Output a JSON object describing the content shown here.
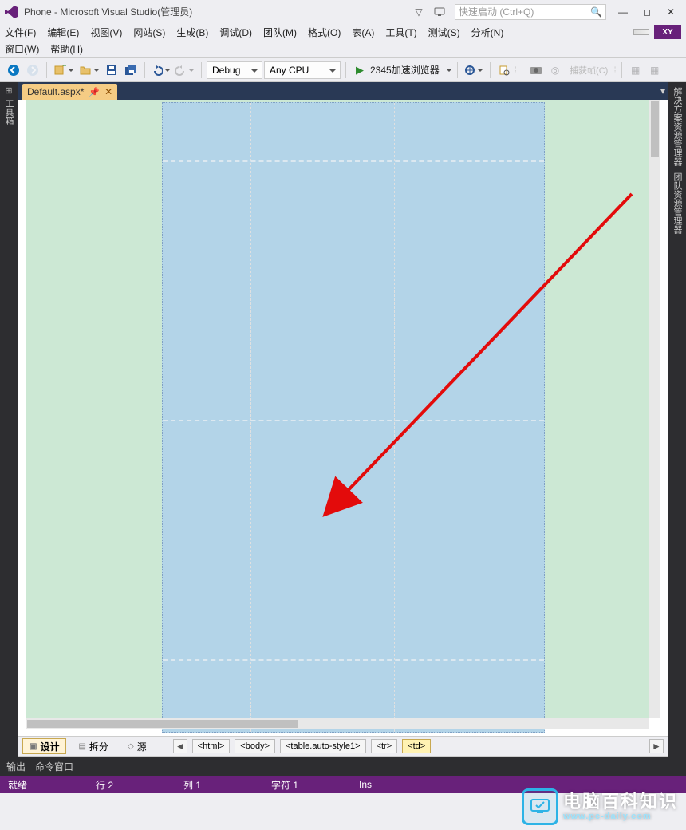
{
  "title": "Phone - Microsoft Visual Studio(管理员)",
  "search_placeholder": "快速启动 (Ctrl+Q)",
  "avatar": "XY",
  "menu1": [
    "文件(F)",
    "编辑(E)",
    "视图(V)",
    "网站(S)",
    "生成(B)",
    "调试(D)",
    "团队(M)",
    "格式(O)",
    "表(A)",
    "工具(T)",
    "测试(S)",
    "分析(N)"
  ],
  "menu2": [
    "窗口(W)",
    "帮助(H)"
  ],
  "toolbar": {
    "config": "Debug",
    "platform": "Any CPU",
    "run_label": "2345加速浏览器",
    "capture": "捕获帧(C)"
  },
  "tab": {
    "label": "Default.aspx*"
  },
  "left_rail": "工具箱",
  "right_rail": [
    "解决方案资源管理器",
    "团队资源管理器"
  ],
  "viewtabs": {
    "design": "设计",
    "split": "拆分",
    "source": "源"
  },
  "breadcrumb": [
    "<html>",
    "<body>",
    "<table.auto-style1>",
    "<tr>",
    "<td>"
  ],
  "panels": {
    "output": "输出",
    "command": "命令窗口"
  },
  "status": {
    "ready": "就绪",
    "line": "行 2",
    "col": "列 1",
    "char": "字符 1",
    "ins": "Ins"
  },
  "watermark": {
    "cn": "电脑百科知识",
    "en": "www.pc-daily.com"
  }
}
